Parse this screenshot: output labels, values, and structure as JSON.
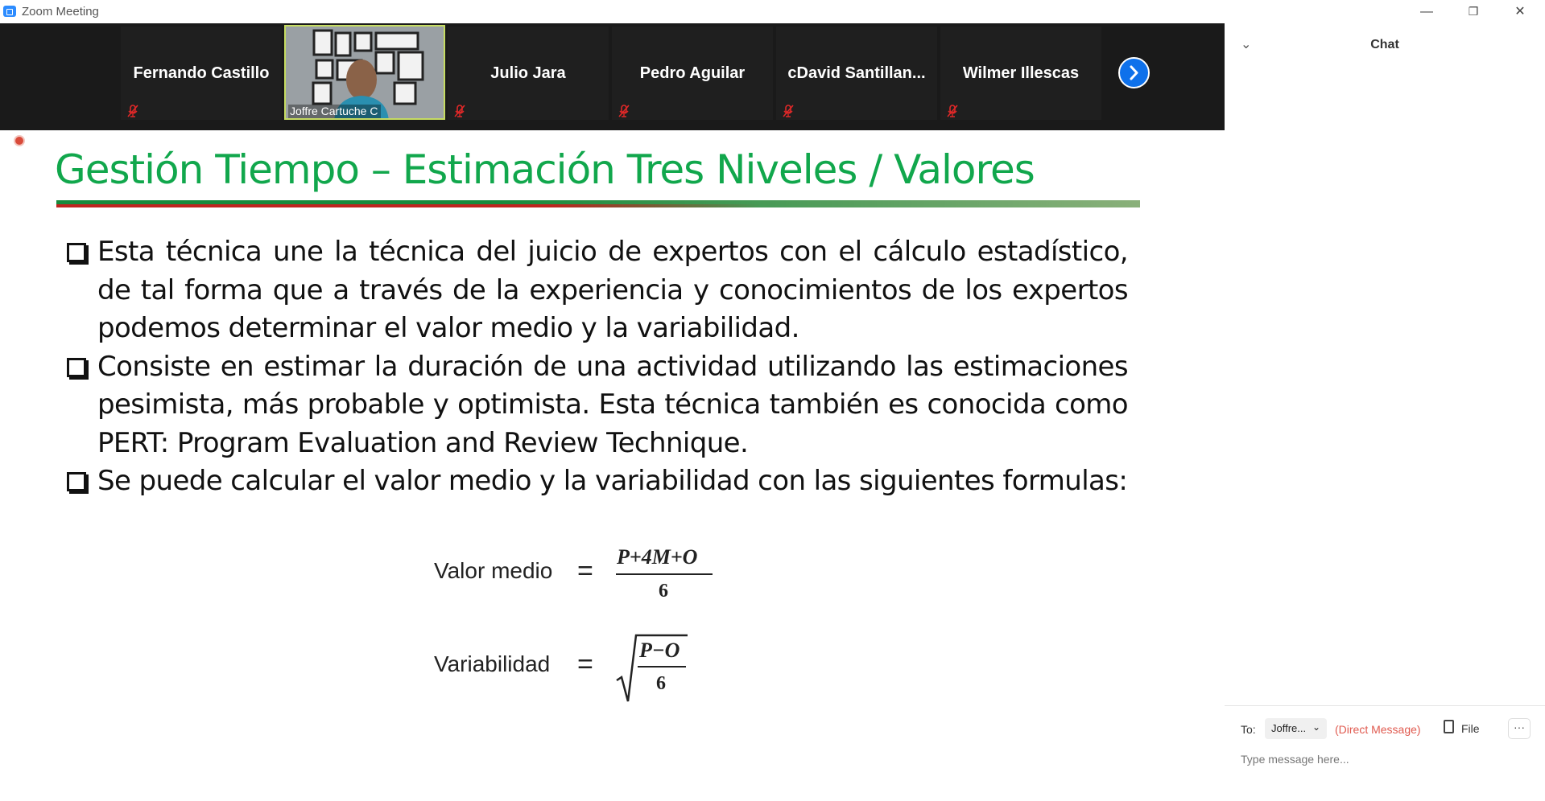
{
  "window": {
    "title": "Zoom Meeting",
    "minimize": "—",
    "restore": "❐",
    "close": "✕"
  },
  "participants": [
    {
      "name": "Fernando Castillo",
      "muted": true
    },
    {
      "name": "Joffre Cartuche C",
      "muted": false,
      "video": true
    },
    {
      "name": "Julio Jara",
      "muted": true
    },
    {
      "name": "Pedro Aguilar",
      "muted": true
    },
    {
      "name": "cDavid  Santillan...",
      "muted": true
    },
    {
      "name": "Wilmer Illescas",
      "muted": true
    }
  ],
  "slide": {
    "title": "Gestión Tiempo – Estimación Tres Niveles / Valores",
    "bullets": [
      "Esta técnica une la técnica del juicio de expertos con el cálculo estadístico, de tal forma que a través de la experiencia y conocimientos de los expertos podemos determinar el valor medio y la variabilidad.",
      "Consiste en estimar la duración de una actividad utilizando las estimaciones pesimista, más probable y optimista. Esta técnica también es conocida como PERT: Program Evaluation and Review Technique.",
      "Se puede calcular el valor medio y la variabilidad con las siguientes formulas:"
    ],
    "formulas": {
      "mean_label": "Valor medio",
      "mean_eq": "=",
      "mean_numerator": "P+4M+O",
      "mean_denominator": "6",
      "var_label": "Variabilidad",
      "var_eq": "=",
      "var_numerator": "P−O",
      "var_denominator": "6"
    }
  },
  "chat": {
    "title": "Chat",
    "to_label": "To:",
    "recipient": "Joffre...",
    "recipient_caret": "⌄",
    "direct_message": "(Direct Message)",
    "file_label": "File",
    "more": "···",
    "placeholder": "Type message here..."
  },
  "colors": {
    "slide_title": "#11a74c",
    "video_strip": "#1a1a1a",
    "active_border": "#c6dc62",
    "next_button": "#0e71eb"
  }
}
